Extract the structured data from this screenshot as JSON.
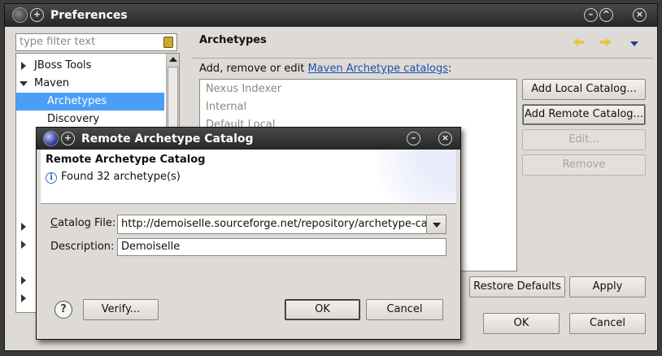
{
  "preferences": {
    "title": "Preferences",
    "filter_placeholder": "type filter text",
    "tree": [
      {
        "label": "JBoss Tools",
        "state": "collapsed"
      },
      {
        "label": "Maven",
        "state": "expanded"
      },
      {
        "label": "Archetypes",
        "state": "selected"
      },
      {
        "label": "Discovery",
        "state": "child"
      }
    ],
    "page_title": "Archetypes",
    "description_prefix": "Add, remove or edit ",
    "description_link": "Maven Archetype catalogs",
    "description_suffix": ":",
    "catalogs": [
      "Nexus Indexer",
      "Internal",
      "Default Local"
    ],
    "buttons": {
      "add_local": "Add Local Catalog...",
      "add_remote": "Add Remote Catalog...",
      "edit": "Edit...",
      "remove": "Remove",
      "restore_defaults": "Restore Defaults",
      "apply": "Apply",
      "ok": "OK",
      "cancel": "Cancel"
    }
  },
  "dialog": {
    "title": "Remote Archetype Catalog",
    "heading": "Remote Archetype Catalog",
    "info": "Found 32 archetype(s)",
    "catalog_file_label": "Catalog File:",
    "catalog_file_value": "http://demoiselle.sourceforge.net/repository/archetype-catalog.xml",
    "description_label": "Description:",
    "description_value": "Demoiselle",
    "buttons": {
      "verify": "Verify...",
      "ok": "OK",
      "cancel": "Cancel"
    }
  },
  "icons": [
    "eclipse-icon",
    "plus-icon",
    "minimize-icon",
    "maximize-icon",
    "close-icon",
    "help-icon",
    "info-icon",
    "back-icon",
    "forward-icon",
    "view-menu-icon",
    "clear-filter-icon",
    "dropdown-arrow-icon"
  ],
  "colors": {
    "selection": "#4a9ff5",
    "link": "#1b4fb0",
    "title_bar": "#2e2e2e"
  }
}
